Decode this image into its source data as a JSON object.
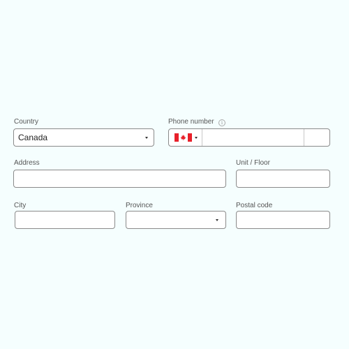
{
  "form": {
    "country": {
      "label": "Country",
      "selected": "Canada"
    },
    "phone": {
      "label": "Phone number",
      "info_glyph": "i",
      "country_flag": "canada-flag",
      "value": "",
      "extension": ""
    },
    "address": {
      "label": "Address",
      "value": ""
    },
    "unit": {
      "label": "Unit / Floor",
      "value": ""
    },
    "city": {
      "label": "City",
      "value": ""
    },
    "province": {
      "label": "Province",
      "selected": ""
    },
    "postal_code": {
      "label": "Postal code",
      "value": ""
    }
  },
  "colors": {
    "background": "#f5fefe",
    "flag_red": "#e8202a",
    "border": "#8a8a8a"
  }
}
